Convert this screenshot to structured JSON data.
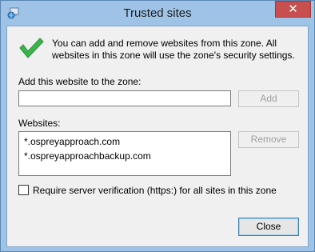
{
  "window": {
    "title": "Trusted sites",
    "close_glyph": "✕",
    "app_icon": "globe-computer-icon",
    "accent_color": "#9ec3e6"
  },
  "info": {
    "icon": "check-icon",
    "text": "You can add and remove websites from this zone. All websites in this zone will use the zone's security settings."
  },
  "add": {
    "label": "Add this website to the zone:",
    "value": "",
    "button": "Add"
  },
  "websites": {
    "label": "Websites:",
    "items": [
      "*.ospreyapproach.com",
      "*.ospreyapproachbackup.com"
    ],
    "remove_button": "Remove"
  },
  "verification": {
    "label": "Require server verification (https:) for all sites in this zone",
    "checked": false
  },
  "close_button": "Close"
}
